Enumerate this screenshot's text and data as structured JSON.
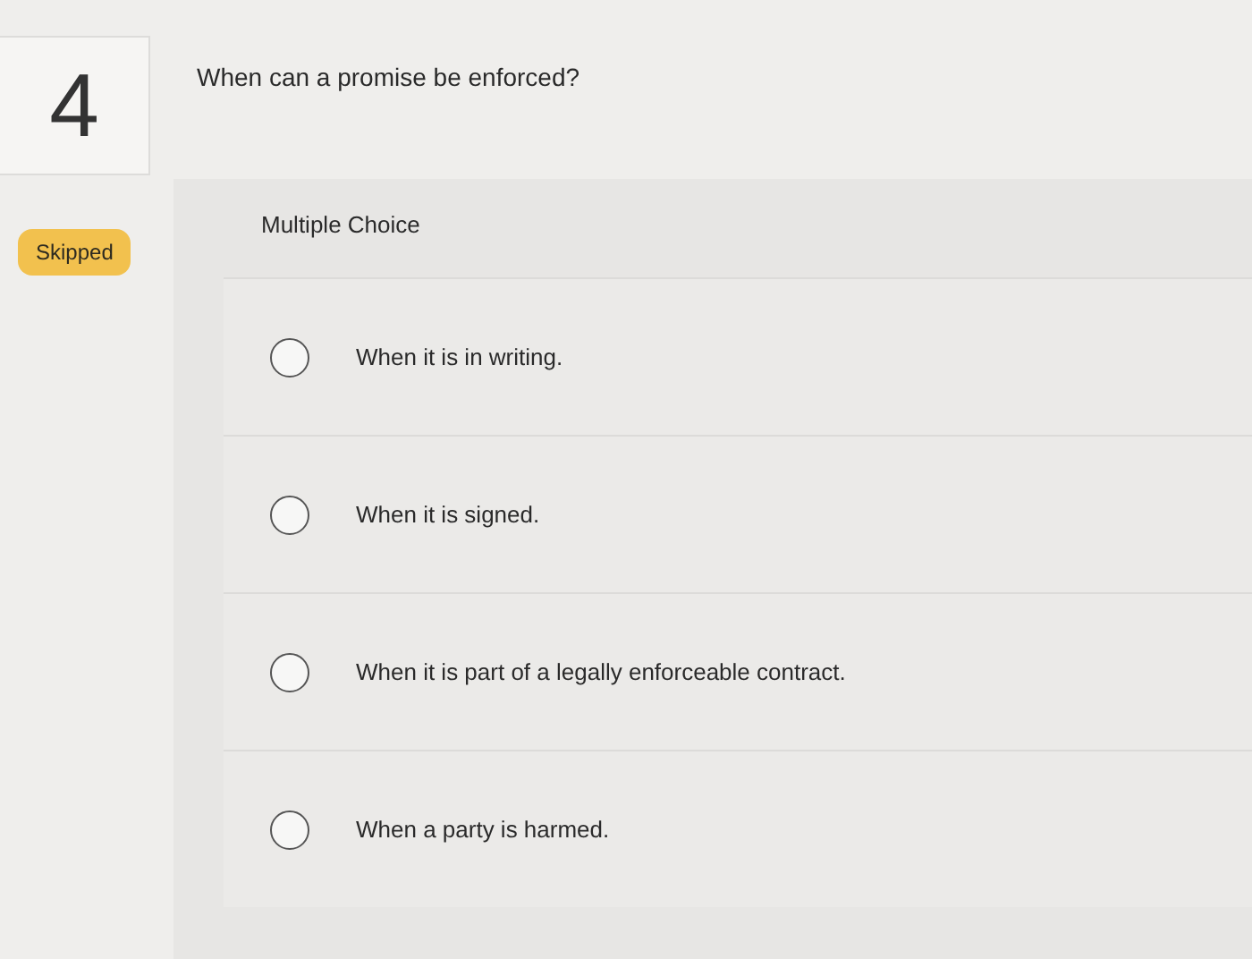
{
  "question_number": "4",
  "status": {
    "label": "Skipped"
  },
  "question": "When can a promise be enforced?",
  "answer_panel": {
    "type_label": "Multiple Choice",
    "options": [
      {
        "label": "When it is in writing.",
        "selected": false
      },
      {
        "label": "When it is signed.",
        "selected": false
      },
      {
        "label": "When it is part of a legally enforceable contract.",
        "selected": false
      },
      {
        "label": "When a party is harmed.",
        "selected": false
      }
    ]
  }
}
